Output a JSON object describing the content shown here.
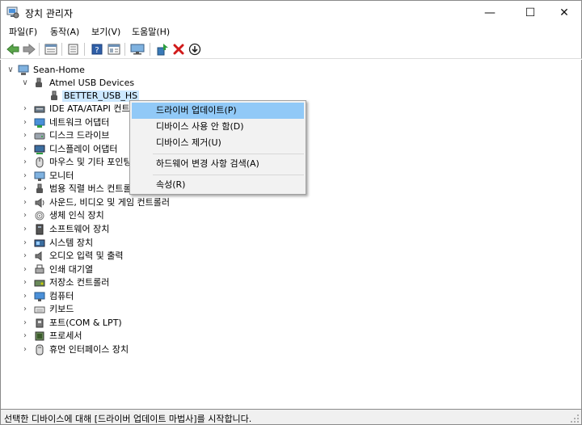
{
  "window": {
    "title": "장치 관리자",
    "minimize_glyph": "—",
    "maximize_glyph": "☐",
    "close_glyph": "✕"
  },
  "menu": [
    "파일(F)",
    "동작(A)",
    "보기(V)",
    "도움말(H)"
  ],
  "toolbar": {
    "buttons": [
      "back-icon",
      "forward-icon",
      "properties-icon",
      "list-icon",
      "help-icon",
      "view-icon",
      "monitor-icon",
      "update-driver-icon",
      "uninstall-icon",
      "download-icon"
    ]
  },
  "tree": {
    "root": "Sean-Home",
    "expanded": "Atmel USB Devices",
    "selected": "BETTER_USB_HS",
    "categories": [
      {
        "label": "IDE ATA/ATAPI 컨트롤러",
        "icon": "ide-controller-icon"
      },
      {
        "label": "네트워크 어댑터",
        "icon": "network-adapter-icon"
      },
      {
        "label": "디스크 드라이브",
        "icon": "disk-drive-icon"
      },
      {
        "label": "디스플레이 어댑터",
        "icon": "display-adapter-icon"
      },
      {
        "label": "마우스 및 기타 포인팅 장치",
        "icon": "mouse-icon"
      },
      {
        "label": "모니터",
        "icon": "monitor-icon"
      },
      {
        "label": "범용 직렬 버스 컨트롤러",
        "icon": "usb-controller-icon"
      },
      {
        "label": "사운드, 비디오 및 게임 컨트롤러",
        "icon": "sound-icon"
      },
      {
        "label": "생체 인식 장치",
        "icon": "biometric-icon"
      },
      {
        "label": "소프트웨어 장치",
        "icon": "software-device-icon"
      },
      {
        "label": "시스템 장치",
        "icon": "system-device-icon"
      },
      {
        "label": "오디오 입력 및 출력",
        "icon": "audio-io-icon"
      },
      {
        "label": "인쇄 대기열",
        "icon": "print-queue-icon"
      },
      {
        "label": "저장소 컨트롤러",
        "icon": "storage-controller-icon"
      },
      {
        "label": "컴퓨터",
        "icon": "computer-icon"
      },
      {
        "label": "키보드",
        "icon": "keyboard-icon"
      },
      {
        "label": "포트(COM & LPT)",
        "icon": "port-icon"
      },
      {
        "label": "프로세서",
        "icon": "processor-icon"
      },
      {
        "label": "휴먼 인터페이스 장치",
        "icon": "hid-icon"
      }
    ]
  },
  "context_menu": {
    "items": [
      "드라이버 업데이트(P)",
      "디바이스 사용 안 함(D)",
      "디바이스 제거(U)",
      "하드웨어 변경 사항 검색(A)",
      "속성(R)"
    ],
    "highlighted_index": 0
  },
  "status": "선택한 디바이스에 대해 [드라이버 업데이트 마법사]를 시작합니다.",
  "colors": {
    "highlight": "#91c9f7",
    "selection": "#cce8ff",
    "menu_bg": "#f2f2f2",
    "status_bg": "#f0f0f0"
  }
}
